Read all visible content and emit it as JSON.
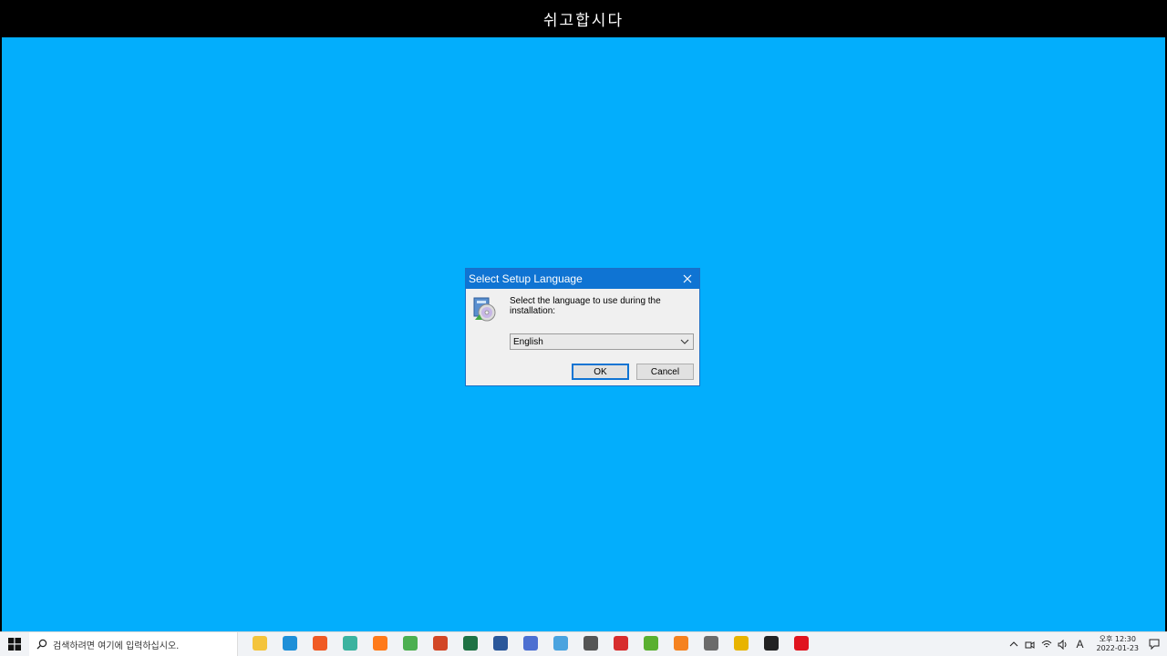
{
  "top_banner": {
    "text": "쉬고합시다"
  },
  "dialog": {
    "title": "Select Setup Language",
    "message": "Select the language to use during the installation:",
    "selected_language": "English",
    "ok_label": "OK",
    "cancel_label": "Cancel"
  },
  "taskbar": {
    "search_placeholder": "검색하려면 여기에 입력하십시오.",
    "apps": [
      {
        "name": "file-explorer-icon",
        "color": "#f4c43c"
      },
      {
        "name": "edge-icon",
        "color": "#1e8fd8"
      },
      {
        "name": "brave-icon",
        "color": "#f05a24"
      },
      {
        "name": "app-s-icon",
        "color": "#3bb39f"
      },
      {
        "name": "firefox-icon",
        "color": "#ff7a1a"
      },
      {
        "name": "chrome-icon",
        "color": "#4caf50"
      },
      {
        "name": "powerpoint-icon",
        "color": "#d24726"
      },
      {
        "name": "excel-icon",
        "color": "#1f7244"
      },
      {
        "name": "word-icon",
        "color": "#2b579a"
      },
      {
        "name": "app-h-icon",
        "color": "#4d6fd1"
      },
      {
        "name": "remote-desktop-icon",
        "color": "#4aa3df"
      },
      {
        "name": "search-tool-icon",
        "color": "#555555"
      },
      {
        "name": "app-se-icon",
        "color": "#d72d2d"
      },
      {
        "name": "app-green-icon",
        "color": "#5ab031"
      },
      {
        "name": "vlc-icon",
        "color": "#f58220"
      },
      {
        "name": "calculator-icon",
        "color": "#6b6b6b"
      },
      {
        "name": "chrome-alt-icon",
        "color": "#e8b400"
      },
      {
        "name": "sticky-notes-icon",
        "color": "#222222"
      },
      {
        "name": "opera-icon",
        "color": "#e0141e"
      }
    ],
    "ime_label": "A",
    "time_period": "오후",
    "time": "12:30",
    "date": "2022-01-23"
  }
}
